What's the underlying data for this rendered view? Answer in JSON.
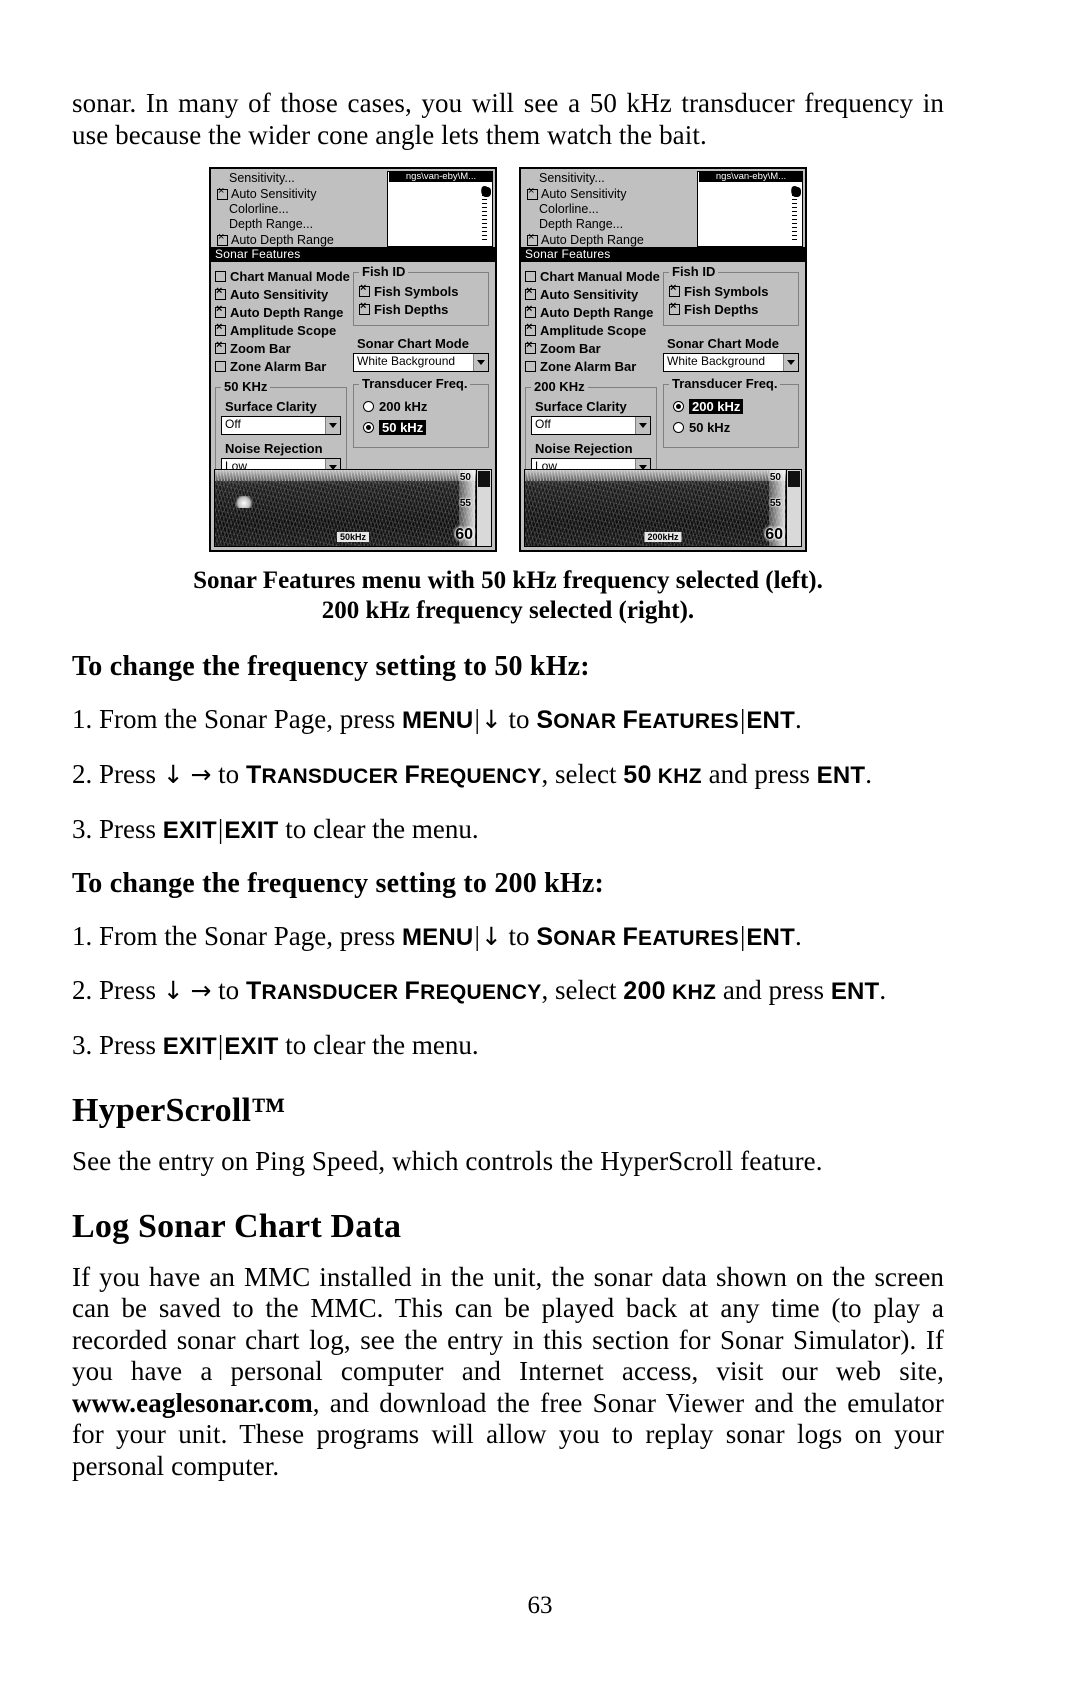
{
  "intro_paragraph": "sonar. In many of those cases, you will see a 50 kHz transducer frequency in use because the wider cone angle lets them watch the bait.",
  "figure": {
    "caption_line1": "Sonar Features menu with 50 kHz frequency selected (left).",
    "caption_line2": "200 kHz frequency selected (right).",
    "panels": [
      {
        "background_menu": {
          "items": [
            {
              "label": "Sensitivity...",
              "checkbox": "none"
            },
            {
              "label": "Auto Sensitivity",
              "checkbox": "checked"
            },
            {
              "label": "Colorline...",
              "checkbox": "none"
            },
            {
              "label": "Depth Range...",
              "checkbox": "none"
            },
            {
              "label": "Auto Depth Range",
              "checkbox": "checked"
            }
          ]
        },
        "preview": {
          "title": "ngs\\van-eby\\M...",
          "depth_value": "0"
        },
        "dialog_title": "Sonar Features",
        "checkboxes": [
          {
            "label": "Chart Manual Mode",
            "state": "unchecked"
          },
          {
            "label": "Auto Sensitivity",
            "state": "checked"
          },
          {
            "label": "Auto Depth Range",
            "state": "checked"
          },
          {
            "label": "Amplitude Scope",
            "state": "checked"
          },
          {
            "label": "Zoom Bar",
            "state": "checked"
          },
          {
            "label": "Zone Alarm Bar",
            "state": "unchecked"
          }
        ],
        "fish_id": {
          "group_label": "Fish ID",
          "options": [
            {
              "label": "Fish Symbols",
              "state": "checked"
            },
            {
              "label": "Fish Depths",
              "state": "checked"
            }
          ]
        },
        "freq_group": {
          "group_label": "50 KHz",
          "surface_clarity_label": "Surface Clarity",
          "surface_clarity_value": "Off",
          "noise_rejection_label": "Noise Rejection",
          "noise_rejection_value": "Low"
        },
        "sonar_chart_mode": {
          "label": "Sonar Chart Mode",
          "value": "White Background"
        },
        "transducer_freq": {
          "group_label": "Transducer Freq.",
          "options": [
            {
              "label": "200 kHz",
              "selected": false
            },
            {
              "label": "50 kHz",
              "selected": true
            }
          ]
        },
        "chart": {
          "freq_label": "50kHz",
          "depth_reading": "60",
          "scale_top": "50",
          "scale_mid": "55"
        }
      },
      {
        "background_menu": {
          "items": [
            {
              "label": "Sensitivity...",
              "checkbox": "none"
            },
            {
              "label": "Auto Sensitivity",
              "checkbox": "checked"
            },
            {
              "label": "Colorline...",
              "checkbox": "none"
            },
            {
              "label": "Depth Range...",
              "checkbox": "none"
            },
            {
              "label": "Auto Depth Range",
              "checkbox": "checked"
            }
          ]
        },
        "preview": {
          "title": "ngs\\van-eby\\M...",
          "depth_value": "0"
        },
        "dialog_title": "Sonar Features",
        "checkboxes": [
          {
            "label": "Chart Manual Mode",
            "state": "unchecked"
          },
          {
            "label": "Auto Sensitivity",
            "state": "checked"
          },
          {
            "label": "Auto Depth Range",
            "state": "checked"
          },
          {
            "label": "Amplitude Scope",
            "state": "checked"
          },
          {
            "label": "Zoom Bar",
            "state": "checked"
          },
          {
            "label": "Zone Alarm Bar",
            "state": "unchecked"
          }
        ],
        "fish_id": {
          "group_label": "Fish ID",
          "options": [
            {
              "label": "Fish Symbols",
              "state": "checked"
            },
            {
              "label": "Fish Depths",
              "state": "checked"
            }
          ]
        },
        "freq_group": {
          "group_label": "200 KHz",
          "surface_clarity_label": "Surface Clarity",
          "surface_clarity_value": "Off",
          "noise_rejection_label": "Noise Rejection",
          "noise_rejection_value": "Low"
        },
        "sonar_chart_mode": {
          "label": "Sonar Chart Mode",
          "value": "White Background"
        },
        "transducer_freq": {
          "group_label": "Transducer Freq.",
          "options": [
            {
              "label": "200 kHz",
              "selected": true
            },
            {
              "label": "50 kHz",
              "selected": false
            }
          ]
        },
        "chart": {
          "freq_label": "200kHz",
          "depth_reading": "60",
          "scale_top": "50",
          "scale_mid": "55"
        }
      }
    ]
  },
  "section_50": {
    "heading": "To change the frequency setting to 50 kHz:",
    "step1": {
      "number": "1.",
      "t1": "From the Sonar Page, press ",
      "key1": "MENU",
      "bar": "|",
      "arrow_down": "↓",
      "t2": " to ",
      "menu_cap": "S",
      "menu_rest": "ONAR ",
      "menu_cap2": "F",
      "menu_rest2": "EATURES",
      "key2": "ENT",
      "period": "."
    },
    "step2": {
      "number": "2.",
      "t1": "Press ",
      "arrow_down": "↓",
      "arrow_right": "→",
      "t2": " to ",
      "menu_cap": "T",
      "menu_rest": "RANSDUCER ",
      "menu_cap2": "F",
      "menu_rest2": "REQUENCY",
      "t3": ", select ",
      "freq_cap": "50",
      "freq_rest": " KHZ",
      "t4": " and press ",
      "key": "ENT",
      "period": "."
    },
    "step3": {
      "number": "3.",
      "t1": "Press ",
      "key1": "EXIT",
      "bar": "|",
      "key2": "EXIT",
      "t2": " to clear the menu."
    }
  },
  "section_200": {
    "heading": "To change the frequency setting to 200 kHz:",
    "step1": {
      "number": "1.",
      "t1": "From the Sonar Page, press ",
      "key1": "MENU",
      "bar": "|",
      "arrow_down": "↓",
      "t2": " to ",
      "menu_cap": "S",
      "menu_rest": "ONAR ",
      "menu_cap2": "F",
      "menu_rest2": "EATURES",
      "key2": "ENT",
      "period": "."
    },
    "step2": {
      "number": "2.",
      "t1": "Press ",
      "arrow_down": "↓",
      "arrow_right": "→",
      "t2": " to ",
      "menu_cap": "T",
      "menu_rest": "RANSDUCER ",
      "menu_cap2": "F",
      "menu_rest2": "REQUENCY",
      "t3": ", select ",
      "freq_cap": "200",
      "freq_rest": " KHZ",
      "t4": " and  press ",
      "key": "ENT",
      "period": "."
    },
    "step3": {
      "number": "3.",
      "t1": "Press ",
      "key1": "EXIT",
      "bar": "|",
      "key2": "EXIT",
      "t2": " to clear the menu."
    }
  },
  "hyperscroll": {
    "heading": "HyperScroll™",
    "body": "See the entry on Ping Speed, which controls the HyperScroll feature."
  },
  "log_sonar": {
    "heading": "Log Sonar Chart Data",
    "body_part1": "If you have an MMC installed in the unit, the sonar data shown on the screen can be saved to the MMC. This can be played back at any time (to play a recorded sonar chart log, see the entry in this section for Sonar Simulator). If you have a personal computer and Internet access, visit our web site, ",
    "website": "www.eaglesonar.com",
    "body_part2": ", and download the free Sonar Viewer and the emulator for your unit. These programs will allow you to replay sonar logs on your personal computer."
  },
  "page_number": "63"
}
